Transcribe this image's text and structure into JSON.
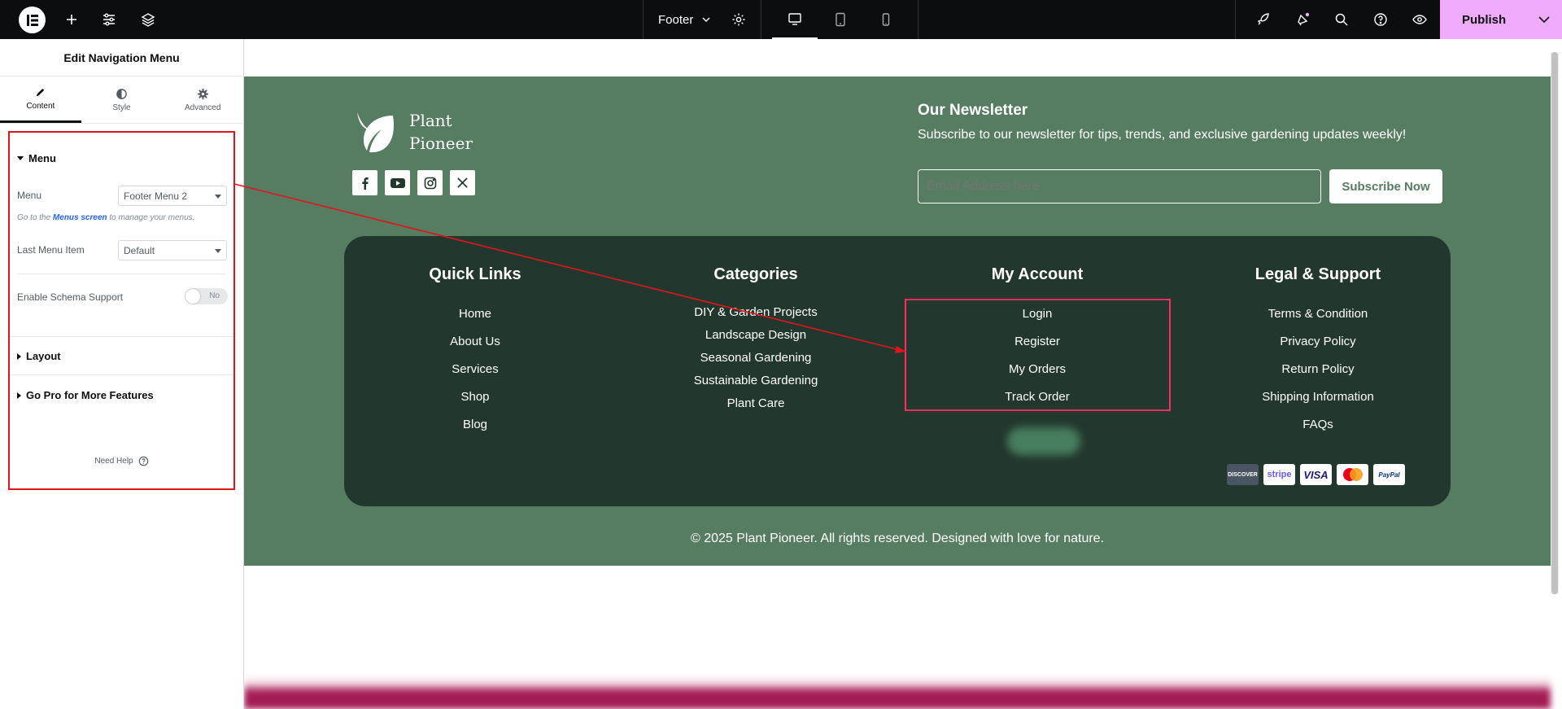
{
  "topbar": {
    "document_name": "Footer",
    "publish_label": "Publish",
    "publish_color": "#f0abfc"
  },
  "panel": {
    "title": "Edit Navigation Menu",
    "tabs": [
      {
        "label": "Content",
        "icon": "pencil-icon"
      },
      {
        "label": "Style",
        "icon": "half-circle-icon"
      },
      {
        "label": "Advanced",
        "icon": "gear-icon"
      }
    ],
    "menu_section": {
      "title": "Menu",
      "menu_label": "Menu",
      "menu_value": "Footer Menu 2",
      "help_prefix": "Go to the ",
      "help_link": "Menus screen",
      "help_suffix": " to manage your menus.",
      "last_item_label": "Last Menu Item",
      "last_item_value": "Default",
      "schema_label": "Enable Schema Support",
      "schema_toggle": "No"
    },
    "layout_title": "Layout",
    "pro_title": "Go Pro for More Features",
    "need_help": "Need Help"
  },
  "footer": {
    "brand_line1": "Plant",
    "brand_line2": "Pioneer",
    "newsletter_title": "Our Newsletter",
    "newsletter_text": "Subscribe to our newsletter for tips, trends, and exclusive gardening updates weekly!",
    "email_placeholder": "Email Address here",
    "subscribe_label": "Subscribe Now",
    "columns": {
      "quick_links": {
        "title": "Quick Links",
        "items": [
          "Home",
          "About Us",
          "Services",
          "Shop",
          "Blog"
        ]
      },
      "categories": {
        "title": "Categories",
        "items": [
          "DIY & Garden Projects",
          "Landscape Design",
          "Seasonal Gardening",
          "Sustainable Gardening",
          "Plant Care"
        ]
      },
      "my_account": {
        "title": "My Account",
        "items": [
          "Login",
          "Register",
          "My Orders",
          "Track Order"
        ]
      },
      "legal": {
        "title": "Legal & Support",
        "items": [
          "Terms & Condition",
          "Privacy Policy",
          "Return Policy",
          "Shipping Information",
          "FAQs"
        ]
      }
    },
    "payments": [
      "DISCOVER",
      "stripe",
      "VISA",
      "mastercard-icon",
      "PayPal"
    ],
    "copyright": "© 2025 Plant Pioneer. All rights reserved. Designed with love for nature.",
    "colors": {
      "footer_bg": "#567c62",
      "card_bg": "#22372d",
      "highlight": "#e3141a"
    }
  }
}
